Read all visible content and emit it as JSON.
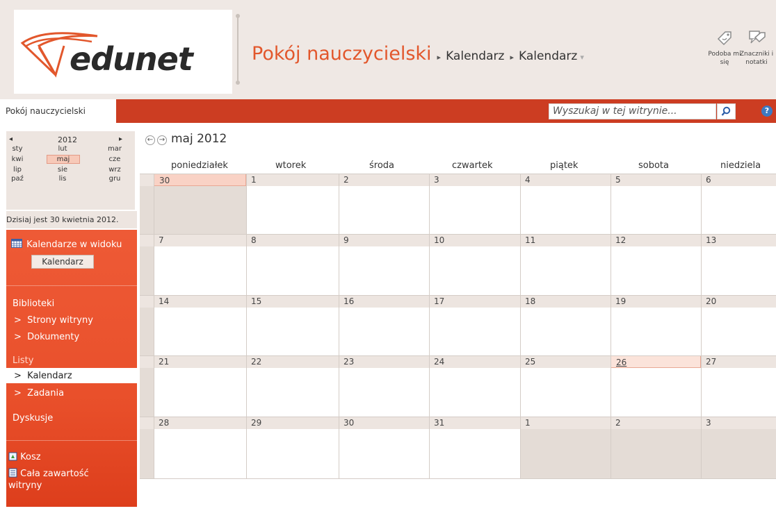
{
  "logo": {
    "text": "edunet"
  },
  "breadcrumb": {
    "site": "Pokój nauczycielski",
    "items": [
      "Kalendarz",
      "Kalendarz"
    ]
  },
  "header_actions": [
    {
      "label_line1": "Podoba mi",
      "label_line2": "się",
      "icon": "like-tag-icon"
    },
    {
      "label_line1": "Znaczniki i",
      "label_line2": "notatki",
      "icon": "tags-notes-icon"
    }
  ],
  "topnav": {
    "home_tab": "Pokój nauczycielski",
    "search_placeholder": "Wyszukaj w tej witrynie...",
    "help": "?"
  },
  "datepicker": {
    "year": "2012",
    "months": [
      [
        "sty",
        "lut",
        "mar"
      ],
      [
        "kwi",
        "maj",
        "cze"
      ],
      [
        "lip",
        "sie",
        "wrz"
      ],
      [
        "paź",
        "lis",
        "gru"
      ]
    ],
    "selected_month": "maj",
    "today_text": "Dzisiaj jest 30 kwietnia 2012."
  },
  "calendars_in_view": {
    "heading": "Kalendarze w widoku",
    "button": "Kalendarz"
  },
  "quicklaunch": {
    "libraries_heading": "Biblioteki",
    "libraries": [
      "Strony witryny",
      "Dokumenty"
    ],
    "lists_heading": "Listy",
    "lists": [
      "Kalendarz",
      "Zadania"
    ],
    "discussions_heading": "Dyskusje",
    "recycle_bin": "Kosz",
    "all_content_line1": "Cała zawartość",
    "all_content_line2": "witryny",
    "bullet": ">"
  },
  "calendar": {
    "title": "maj 2012",
    "weekdays": [
      "poniedziałek",
      "wtorek",
      "środa",
      "czwartek",
      "piątek",
      "sobota",
      "niedziela"
    ],
    "weeks": [
      [
        "30",
        "1",
        "2",
        "3",
        "4",
        "5",
        "6"
      ],
      [
        "7",
        "8",
        "9",
        "10",
        "11",
        "12",
        "13"
      ],
      [
        "14",
        "15",
        "16",
        "17",
        "18",
        "19",
        "20"
      ],
      [
        "21",
        "22",
        "23",
        "24",
        "25",
        "26",
        "27"
      ],
      [
        "28",
        "29",
        "30",
        "31",
        "1",
        "2",
        "3"
      ]
    ],
    "today_cell": "30",
    "highlighted_cell": "26"
  },
  "colors": {
    "accent": "#e2572c",
    "nav_red": "#cc3d22",
    "panel_red": "#e9502b",
    "beige": "#ede5e0"
  }
}
